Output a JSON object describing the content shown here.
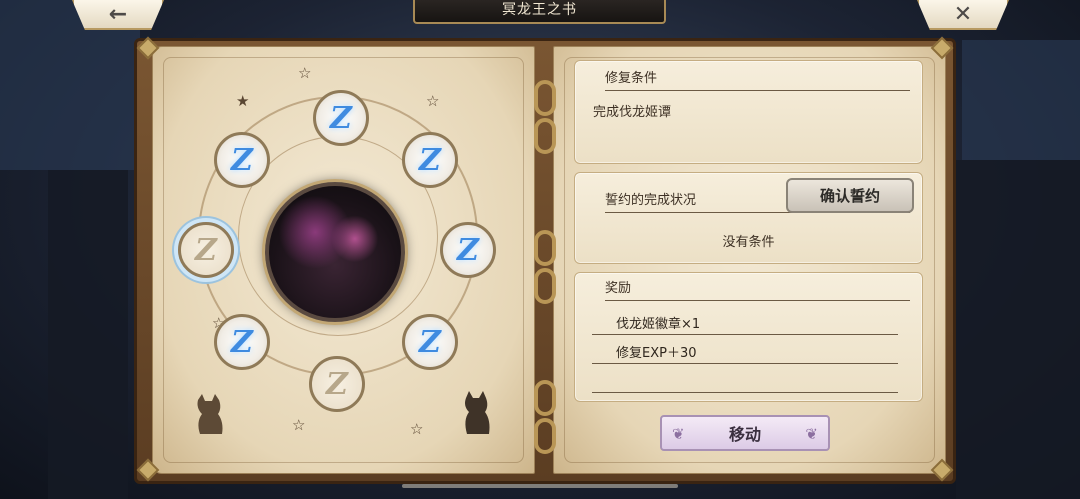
{
  "header": {
    "title": "冥龙王之书",
    "back_icon": "←",
    "close_icon": "✕"
  },
  "circle": {
    "nodes": [
      {
        "glyph": "Z",
        "state": "active"
      },
      {
        "glyph": "Z",
        "state": "active"
      },
      {
        "glyph": "Z",
        "state": "active"
      },
      {
        "glyph": "Z",
        "state": "active"
      },
      {
        "glyph": "Z",
        "state": "active"
      },
      {
        "glyph": "Z",
        "state": "inactive"
      },
      {
        "glyph": "Z",
        "state": "active"
      },
      {
        "glyph": "Z",
        "state": "inactive"
      }
    ]
  },
  "repair": {
    "heading": "修复条件",
    "condition": "完成伐龙姬谭"
  },
  "pledge": {
    "heading": "誓约的完成状况",
    "confirm_label": "确认誓约",
    "status": "没有条件"
  },
  "rewards": {
    "heading": "奖励",
    "items": [
      {
        "label": "伐龙姬徽章×1",
        "icon": "badge-icon"
      },
      {
        "label": "修复EXP＋30",
        "icon": "exp-icon"
      }
    ]
  },
  "move_label": "移动"
}
